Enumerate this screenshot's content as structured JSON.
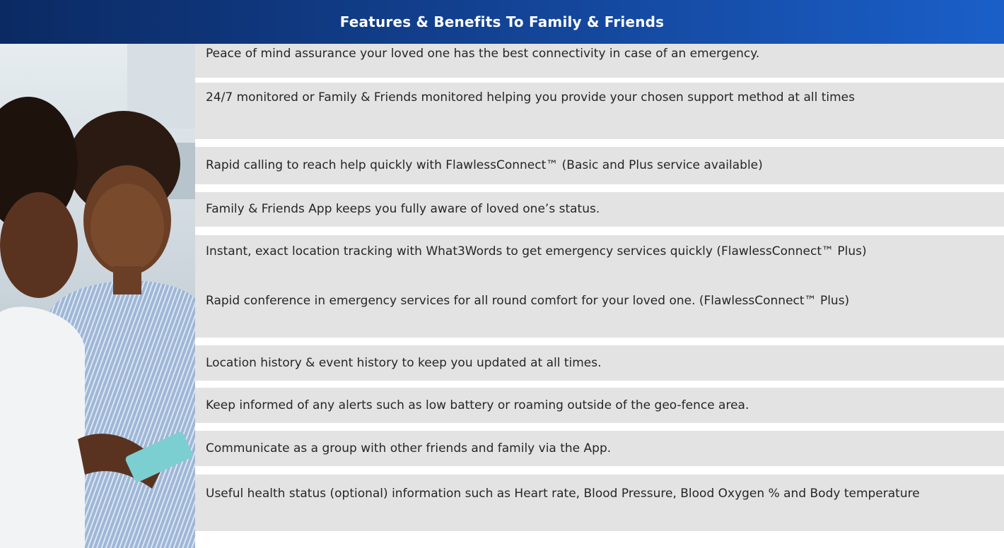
{
  "header": {
    "title": "Features & Benefits To Family & Friends"
  },
  "photo": {
    "icon": "people-photo"
  },
  "features": [
    "Peace of mind assurance your loved one has the best connectivity in case of an emergency.",
    "24/7 monitored or Family & Friends monitored helping you provide your chosen support method at all times",
    "Rapid calling to reach help quickly with FlawlessConnect™ (Basic and Plus service available)",
    "Family & Friends App keeps you fully aware of loved one’s status.",
    "Instant, exact location tracking with What3Words  to get emergency services quickly (FlawlessConnect™ Plus)",
    "Rapid conference in emergency services for all round comfort for your loved one. (FlawlessConnect™ Plus)",
    "Location history & event history  to keep you updated at all times.",
    "Keep informed of any alerts such as low battery or roaming outside of the geo-fence area.",
    "Communicate as a group with other friends and family via the App.",
    "Useful health status (optional) information such as Heart rate, Blood Pressure, Blood Oxygen % and Body temperature"
  ],
  "colors": {
    "header_start": "#0b2a63",
    "header_end": "#1a5fc9",
    "row_background": "#e3e3e3"
  }
}
